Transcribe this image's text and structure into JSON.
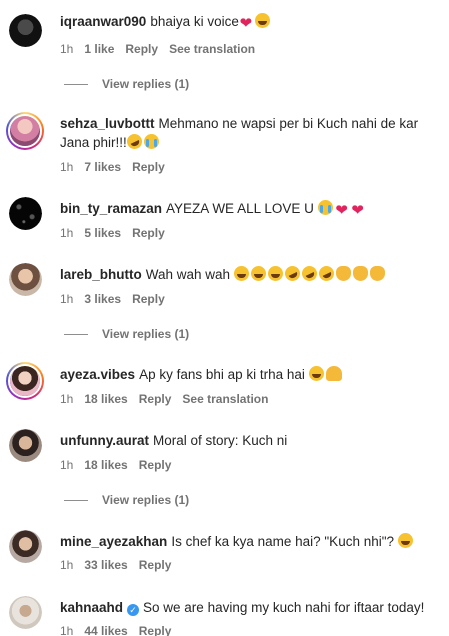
{
  "comments": [
    {
      "username": "iqraanwar090",
      "text": "bhaiya ki voice",
      "time": "1h",
      "likes": "1 like",
      "reply": "Reply",
      "translate": "See translation",
      "replies": "View replies (1)"
    },
    {
      "username": "sehza_luvbottt",
      "text": "Mehmano ne wapsi per bi Kuch nahi de kar Jana phir!!!",
      "time": "1h",
      "likes": "7 likes",
      "reply": "Reply"
    },
    {
      "username": "bin_ty_ramazan",
      "text": "AYEZA WE ALL LOVE U",
      "time": "1h",
      "likes": "5 likes",
      "reply": "Reply"
    },
    {
      "username": "lareb_bhutto",
      "text": "Wah wah wah",
      "time": "1h",
      "likes": "3 likes",
      "reply": "Reply",
      "replies": "View replies (1)"
    },
    {
      "username": "ayeza.vibes",
      "text": "Ap ky fans bhi ap ki trha hai",
      "time": "1h",
      "likes": "18 likes",
      "reply": "Reply",
      "translate": "See translation"
    },
    {
      "username": "unfunny.aurat",
      "text": "Moral of story: Kuch ni",
      "time": "1h",
      "likes": "18 likes",
      "reply": "Reply",
      "replies": "View replies (1)"
    },
    {
      "username": "mine_ayezakhan",
      "text": "Is chef ka kya name hai? \"Kuch nhi\"?",
      "time": "1h",
      "likes": "33 likes",
      "reply": "Reply"
    },
    {
      "username": "kahnaahd",
      "text": "So we are having my kuch nahi for iftaar today!",
      "time": "1h",
      "likes": "44 likes",
      "reply": "Reply"
    }
  ],
  "colors": {
    "text": "#262626",
    "muted": "#737373",
    "verified": "#3897f0"
  }
}
